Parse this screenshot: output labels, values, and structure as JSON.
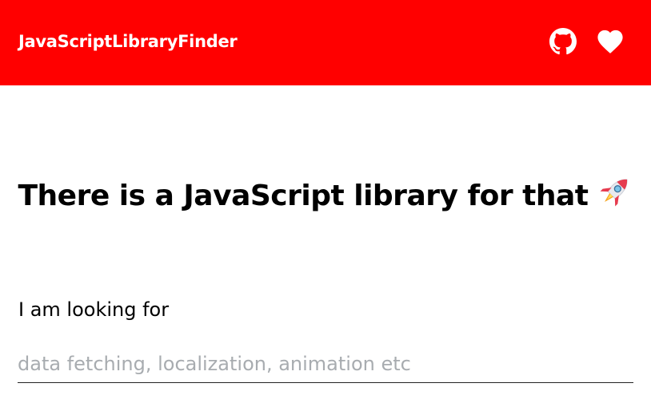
{
  "header": {
    "brand": "JavaScriptLibraryFinder",
    "background_color": "#ff0000",
    "icons": [
      "github-icon",
      "heart-icon"
    ]
  },
  "main": {
    "headline": "There is a JavaScript library for that",
    "headline_icon": "rocket-icon",
    "search_label": "I am looking for",
    "search_placeholder": "data fetching, localization, animation etc",
    "search_value": ""
  }
}
